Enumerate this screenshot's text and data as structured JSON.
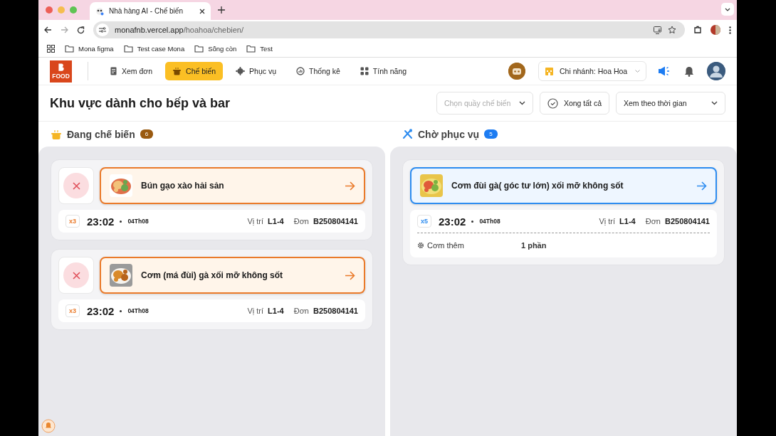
{
  "browser": {
    "tab_title": "Nhà hàng AI - Chế biến",
    "url_host": "monafnb.vercel.app",
    "url_path": "/hoahoa/chebien/",
    "bookmarks": [
      "Mona figma",
      "Test case Mona",
      "Sống còn",
      "Test"
    ]
  },
  "header": {
    "logo_text": "FOOD",
    "nav": [
      {
        "label": "Xem đơn",
        "selected": false
      },
      {
        "label": "Chế biến",
        "selected": true
      },
      {
        "label": "Phục vụ",
        "selected": false
      },
      {
        "label": "Thống kê",
        "selected": false
      },
      {
        "label": "Tính năng",
        "selected": false
      }
    ],
    "branch": "Chi nhánh: Hoa Hoa"
  },
  "page": {
    "title": "Khu vực dành cho bếp và bar",
    "counter_select": {
      "placeholder": "Chọn quầy chế biến"
    },
    "done_all": "Xong tất cả",
    "view_select": {
      "value": "Xem theo thời gian"
    }
  },
  "columns": [
    {
      "kind": "cooking",
      "title": "Đang chế biến",
      "count": "6",
      "orders": [
        {
          "name": "Bún gạo xào hải sản",
          "qty": "x3",
          "time": "23:02",
          "date": "04Th08",
          "position_label": "Vị trí",
          "position": "L1-4",
          "order_label": "Đơn",
          "order_code": "B250804141"
        },
        {
          "name": "Cơm (má đùi) gà xối mỡ không sốt",
          "qty": "x3",
          "time": "23:02",
          "date": "04Th08",
          "position_label": "Vị trí",
          "position": "L1-4",
          "order_label": "Đơn",
          "order_code": "B250804141"
        }
      ]
    },
    {
      "kind": "serving",
      "title": "Chờ phục vụ",
      "count": "5",
      "orders": [
        {
          "name": "Cơm đùi gà( góc tư lớn) xối mỡ không sốt",
          "qty": "x5",
          "time": "23:02",
          "date": "04Th08",
          "position_label": "Vị trí",
          "position": "L1-4",
          "order_label": "Đơn",
          "order_code": "B250804141",
          "extras": [
            {
              "name": "Cơm thêm",
              "amount": "1 phần"
            }
          ]
        }
      ]
    }
  ]
}
